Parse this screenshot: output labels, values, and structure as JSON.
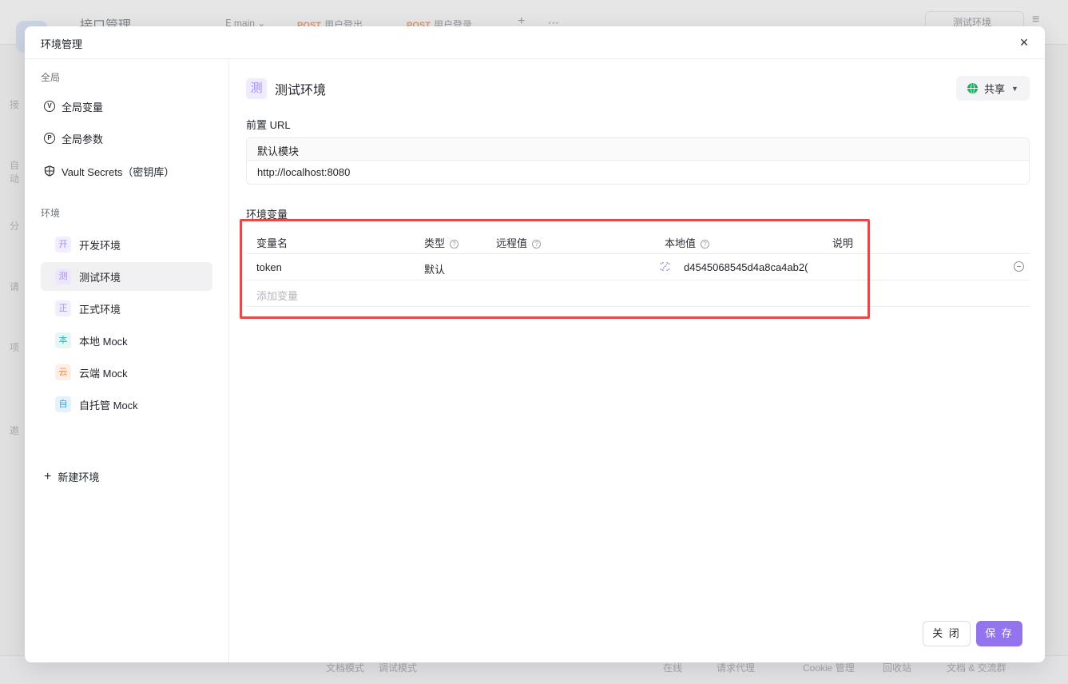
{
  "background": {
    "app_title": "接口管理",
    "branch": "main",
    "tabs": [
      {
        "method": "POST",
        "label": "用户登出"
      },
      {
        "method": "POST",
        "label": "用户登录"
      }
    ],
    "env_selector": "测试环境",
    "side_labels": [
      "接",
      "自动",
      "分",
      "请",
      "项",
      "邀"
    ],
    "footer": [
      "文档模式",
      "调试模式",
      "在线",
      "请求代理",
      "Cookie 管理",
      "回收站",
      "文档 & 交流群"
    ]
  },
  "modal": {
    "title": "环境管理",
    "close_icon": "×"
  },
  "left": {
    "global_label": "全局",
    "global_items": [
      {
        "icon": "V",
        "label": "全局变量"
      },
      {
        "icon": "P",
        "label": "全局参数"
      },
      {
        "icon": "shield",
        "label": "Vault Secrets（密钥库）"
      }
    ],
    "env_label": "环境",
    "envs": [
      {
        "badge": "开",
        "label": "开发环境",
        "color": "#a58cf3",
        "bg": "#f2eefe"
      },
      {
        "badge": "测",
        "label": "测试环境",
        "color": "#a58cf3",
        "bg": "#ece7fd"
      },
      {
        "badge": "正",
        "label": "正式环境",
        "color": "#a58cf3",
        "bg": "#f2eefe"
      },
      {
        "badge": "本",
        "label": "本地 Mock",
        "color": "#2fb8b0",
        "bg": "#e4f6f5"
      },
      {
        "badge": "云",
        "label": "云端 Mock",
        "color": "#f08a4b",
        "bg": "#fdefe5"
      },
      {
        "badge": "自",
        "label": "自托管 Mock",
        "color": "#3b9fd8",
        "bg": "#e5f2fb"
      }
    ],
    "new_env": "新建环境"
  },
  "right": {
    "env_badge": "测",
    "env_name": "测试环境",
    "share_label": "共享",
    "prefix_url_label": "前置 URL",
    "module_name": "默认模块",
    "module_url": "http://localhost:8080",
    "env_vars_label": "环境变量",
    "table_headers": {
      "name": "变量名",
      "type": "类型",
      "remote": "远程值",
      "local": "本地值",
      "desc": "说明"
    },
    "rows": [
      {
        "name": "token",
        "type": "默认",
        "remote": "",
        "local": "d4545068545d4a8ca4ab2(",
        "desc": ""
      }
    ],
    "add_placeholder": "添加变量"
  },
  "footer": {
    "close_label": "关 闭",
    "save_label": "保 存"
  },
  "colors": {
    "accent": "#9373ee",
    "highlight": "#e34b4b",
    "share_globe": "#19b35a"
  }
}
